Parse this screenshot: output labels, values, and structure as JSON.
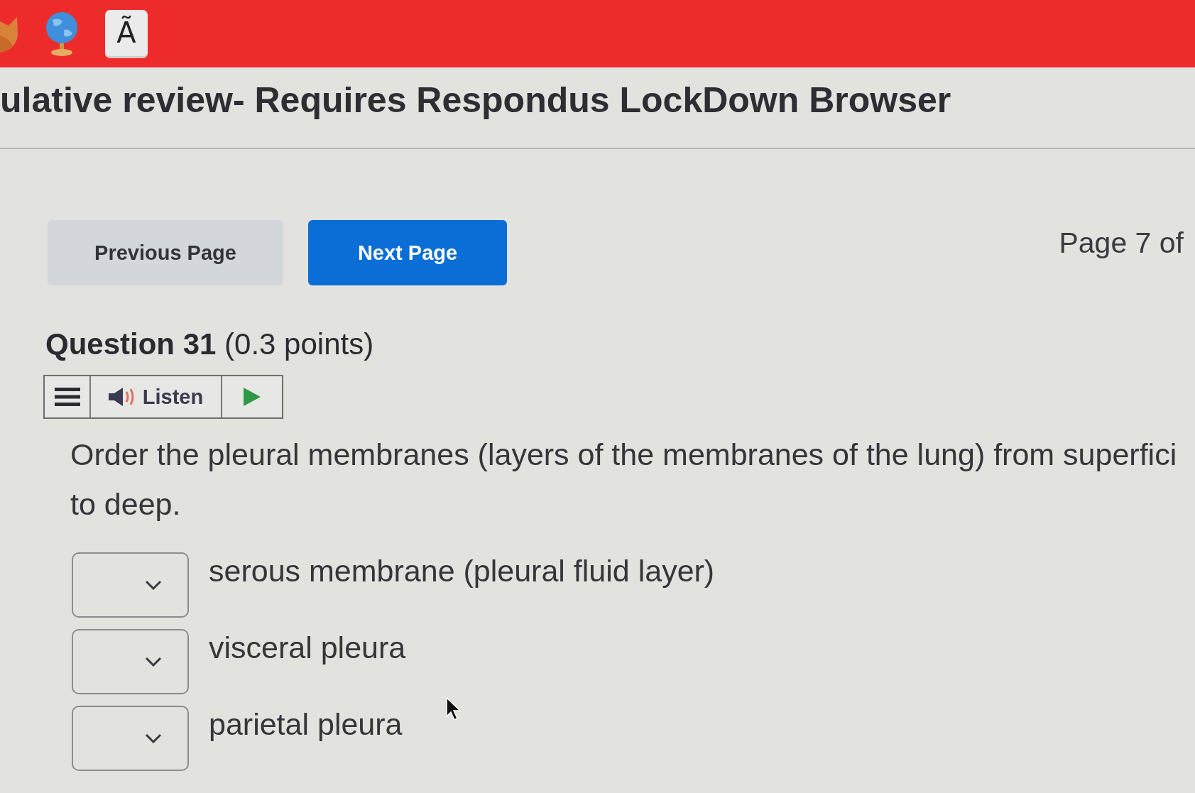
{
  "top_bar": {
    "key_label": "Ã"
  },
  "page_title": "ulative review- Requires Respondus LockDown Browser",
  "navigation": {
    "buttons": [
      {
        "kind": "secondary",
        "label": "Previous Page"
      },
      {
        "kind": "primary",
        "label": "Next Page"
      }
    ],
    "page_indicator": "Page 7 of"
  },
  "question": {
    "heading": "**Question 31** (0.3 points)",
    "listen_toolbar": {
      "label": "Listen"
    },
    "text_lines": [
      "Order the pleural membranes (layers of the membranes of the lung) from superfici",
      "to deep."
    ],
    "answers": [
      {
        "label": "serous membrane (pleural fluid layer)"
      },
      {
        "label": "visceral pleura"
      },
      {
        "label": "parietal pleura"
      }
    ]
  }
}
